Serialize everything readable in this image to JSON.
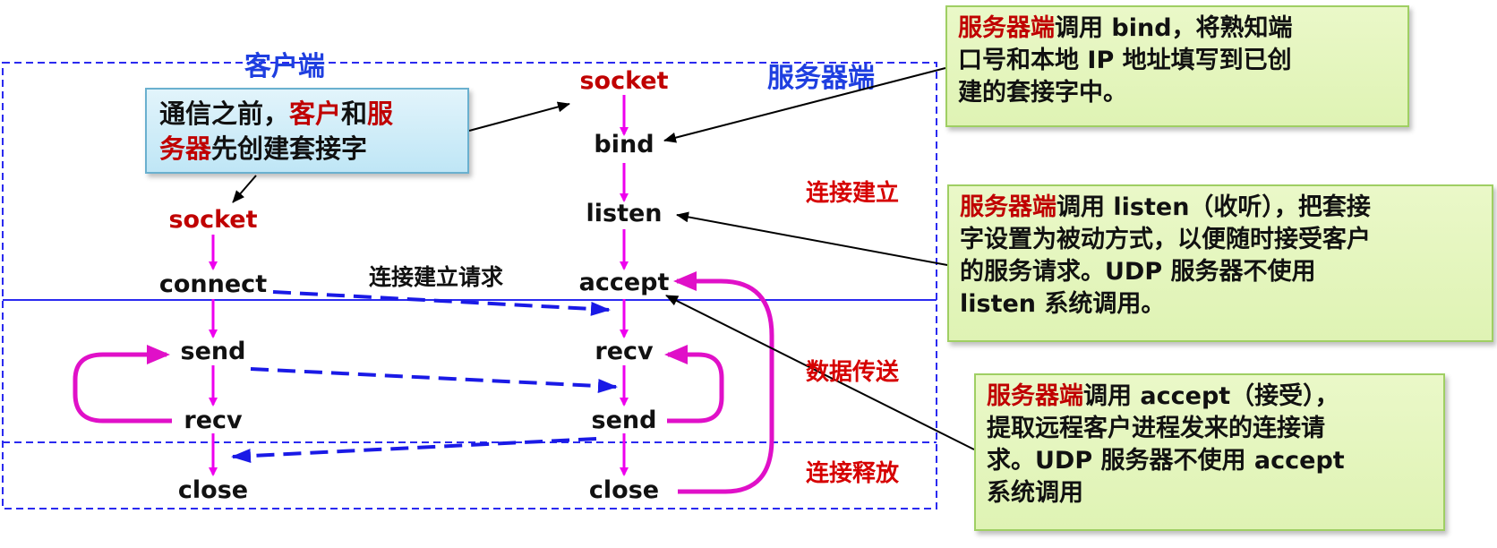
{
  "regions": {
    "client_title": "客户端",
    "server_title": "服务器端"
  },
  "client_nodes": {
    "socket": "socket",
    "connect": "connect",
    "send": "send",
    "recv": "recv",
    "close": "close"
  },
  "server_nodes": {
    "socket": "socket",
    "bind": "bind",
    "listen": "listen",
    "accept": "accept",
    "recv": "recv",
    "send": "send",
    "close": "close"
  },
  "phases": {
    "establish": "连接建立",
    "transfer": "数据传送",
    "release": "连接释放"
  },
  "connect_request_label": "连接建立请求",
  "intro_box": {
    "t1": "通信之前，",
    "t2": "客户",
    "t3": "和",
    "t4": "服",
    "t5": "务器",
    "t6": "先创建套接字"
  },
  "callouts": {
    "bind": {
      "highlight": "服务器端",
      "l1": "调用 bind，将熟知端",
      "l2": "口号和本地 IP 地址填写到已创",
      "l3": "建的套接字中。"
    },
    "listen": {
      "highlight": "服务器端",
      "l1": "调用 listen（收听），把套接",
      "l2": "字设置为被动方式，以便随时接受客户",
      "l3": "的服务请求。UDP 服务器不使用",
      "l4": "listen 系统调用。"
    },
    "accept": {
      "highlight": "服务器端",
      "l1": "调用 accept（接受），",
      "l2": "提取远程客户进程发来的连接请",
      "l3": "求。UDP 服务器不使用 accept",
      "l4": "系统调用"
    }
  },
  "colors": {
    "flow_arrow": "#ee00ee",
    "message_arrow": "#1a1ae6",
    "region_border": "#2a2af0",
    "emphasis_text": "#c00000",
    "phase_text": "#d60000"
  }
}
